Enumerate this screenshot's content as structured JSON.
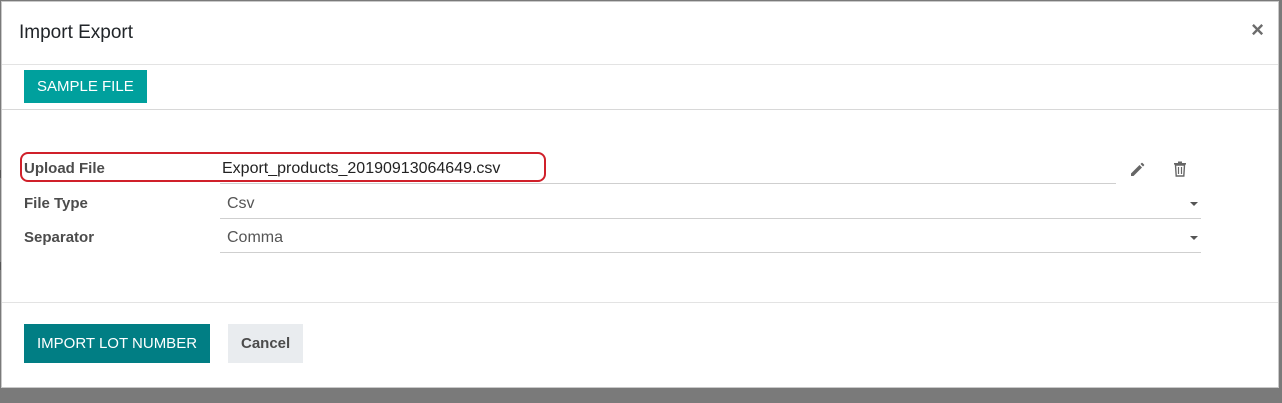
{
  "dialog": {
    "title": "Import Export",
    "close_symbol": "×"
  },
  "toolbar": {
    "sample_file_label": "SAMPLE FILE"
  },
  "form": {
    "upload": {
      "label": "Upload File",
      "value": "Export_products_20190913064649.csv",
      "edit_icon": "pencil-icon",
      "delete_icon": "trash-icon"
    },
    "file_type": {
      "label": "File Type",
      "value": "Csv"
    },
    "separator": {
      "label": "Separator",
      "value": "Comma"
    }
  },
  "footer": {
    "primary_label": "IMPORT LOT NUMBER",
    "cancel_label": "Cancel"
  },
  "colors": {
    "sample_button": "#00a09d",
    "primary_button": "#017e84",
    "highlight": "#d0202a"
  }
}
